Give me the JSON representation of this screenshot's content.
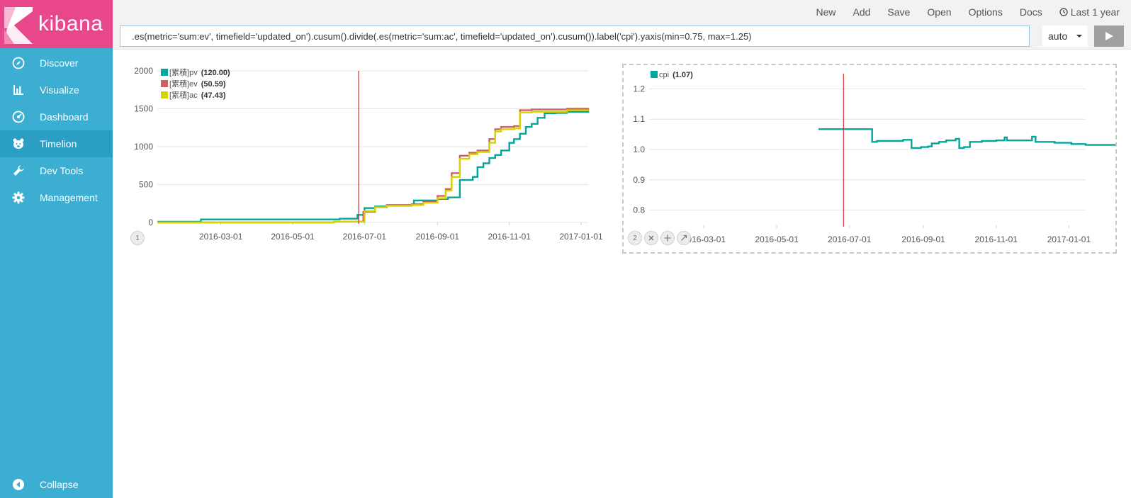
{
  "app": {
    "title": "kibana"
  },
  "sidebar": {
    "items": [
      {
        "label": "Discover",
        "icon": "compass-icon"
      },
      {
        "label": "Visualize",
        "icon": "bar-chart-icon"
      },
      {
        "label": "Dashboard",
        "icon": "gauge-icon"
      },
      {
        "label": "Timelion",
        "icon": "bear-icon"
      },
      {
        "label": "Dev Tools",
        "icon": "wrench-icon"
      },
      {
        "label": "Management",
        "icon": "gear-icon"
      }
    ],
    "active": "Timelion",
    "collapse_label": "Collapse"
  },
  "topmenu": {
    "new": "New",
    "add": "Add",
    "save": "Save",
    "open": "Open",
    "options": "Options",
    "docs": "Docs",
    "time_range": "Last 1 year"
  },
  "expression": ".es(metric='sum:ev', timefield='updated_on').cusum().divide(.es(metric='sum:ac', timefield='updated_on').cusum()).label('cpi').yaxis(min=0.75, max=1.25)",
  "interval": "auto",
  "colors": {
    "pv": "#00a69b",
    "ev": "#d0605e",
    "ac": "#d4d400",
    "marker": "#d63030",
    "sidebar": "#3caed2",
    "logo": "#e8488b"
  },
  "panels": {
    "panel1": {
      "index": "1"
    },
    "panel2": {
      "index": "2"
    }
  },
  "chart_data": [
    {
      "type": "line",
      "series": [
        {
          "name": "[累積]pv",
          "legend_value": "(120.00)",
          "points": [
            [
              "2016-01-07",
              10
            ],
            [
              "2016-02-12",
              10
            ],
            [
              "2016-02-13",
              40
            ],
            [
              "2016-06-10",
              40
            ],
            [
              "2016-06-10",
              50
            ],
            [
              "2016-06-22",
              50
            ],
            [
              "2016-06-25",
              100
            ],
            [
              "2016-07-01",
              190
            ],
            [
              "2016-07-10",
              210
            ],
            [
              "2016-07-20",
              230
            ],
            [
              "2016-08-10",
              230
            ],
            [
              "2016-08-12",
              290
            ],
            [
              "2016-08-31",
              290
            ],
            [
              "2016-09-01",
              310
            ],
            [
              "2016-09-10",
              330
            ],
            [
              "2016-09-20",
              560
            ],
            [
              "2016-10-01",
              600
            ],
            [
              "2016-10-05",
              730
            ],
            [
              "2016-10-10",
              780
            ],
            [
              "2016-10-15",
              850
            ],
            [
              "2016-10-20",
              890
            ],
            [
              "2016-10-25",
              950
            ],
            [
              "2016-11-01",
              1050
            ],
            [
              "2016-11-05",
              1100
            ],
            [
              "2016-11-10",
              1170
            ],
            [
              "2016-11-15",
              1260
            ],
            [
              "2016-11-20",
              1300
            ],
            [
              "2016-11-25",
              1380
            ],
            [
              "2016-12-01",
              1440
            ],
            [
              "2016-12-10",
              1445
            ],
            [
              "2016-12-20",
              1460
            ],
            [
              "2017-01-07",
              1500
            ]
          ]
        },
        {
          "name": "[累積]ev",
          "legend_value": "(50.59)",
          "points": [
            [
              "2016-01-07",
              0
            ],
            [
              "2016-06-04",
              0
            ],
            [
              "2016-06-05",
              10
            ],
            [
              "2016-06-28",
              10
            ],
            [
              "2016-06-30",
              140
            ],
            [
              "2016-07-10",
              200
            ],
            [
              "2016-07-20",
              230
            ],
            [
              "2016-08-10",
              240
            ],
            [
              "2016-08-20",
              270
            ],
            [
              "2016-09-01",
              350
            ],
            [
              "2016-09-08",
              440
            ],
            [
              "2016-09-13",
              650
            ],
            [
              "2016-09-20",
              880
            ],
            [
              "2016-09-28",
              920
            ],
            [
              "2016-10-05",
              950
            ],
            [
              "2016-10-15",
              1100
            ],
            [
              "2016-10-20",
              1230
            ],
            [
              "2016-10-25",
              1260
            ],
            [
              "2016-11-05",
              1270
            ],
            [
              "2016-11-10",
              1480
            ],
            [
              "2016-11-20",
              1490
            ],
            [
              "2016-12-20",
              1500
            ],
            [
              "2017-01-07",
              1510
            ]
          ]
        },
        {
          "name": "[累積]ac",
          "legend_value": "(47.43)",
          "points": [
            [
              "2016-01-07",
              0
            ],
            [
              "2016-06-04",
              0
            ],
            [
              "2016-06-05",
              10
            ],
            [
              "2016-06-28",
              10
            ],
            [
              "2016-07-01",
              150
            ],
            [
              "2016-07-10",
              200
            ],
            [
              "2016-07-20",
              220
            ],
            [
              "2016-08-10",
              230
            ],
            [
              "2016-08-20",
              260
            ],
            [
              "2016-09-01",
              320
            ],
            [
              "2016-09-08",
              420
            ],
            [
              "2016-09-13",
              600
            ],
            [
              "2016-09-20",
              840
            ],
            [
              "2016-09-28",
              900
            ],
            [
              "2016-10-05",
              930
            ],
            [
              "2016-10-15",
              1050
            ],
            [
              "2016-10-20",
              1200
            ],
            [
              "2016-10-25",
              1230
            ],
            [
              "2016-11-05",
              1240
            ],
            [
              "2016-11-10",
              1450
            ],
            [
              "2016-11-20",
              1460
            ],
            [
              "2016-12-20",
              1480
            ],
            [
              "2017-01-07",
              1490
            ]
          ]
        }
      ],
      "marker_date": "2016-06-26",
      "x_ticks": [
        "2016-03-01",
        "2016-05-01",
        "2016-07-01",
        "2016-09-01",
        "2016-11-01",
        "2017-01-01"
      ],
      "y_ticks": [
        0,
        500,
        1000,
        1500,
        2000
      ],
      "xlim": [
        "2016-01-07",
        "2017-01-07"
      ],
      "ylim": [
        0,
        2000
      ],
      "legend": "top-left",
      "grid": true
    },
    {
      "type": "line",
      "series": [
        {
          "name": "cpi",
          "legend_value": "(1.07)",
          "points": [
            [
              "2016-06-05",
              1.067
            ],
            [
              "2016-07-18",
              1.067
            ],
            [
              "2016-07-20",
              1.025
            ],
            [
              "2016-07-24",
              1.028
            ],
            [
              "2016-08-10",
              1.028
            ],
            [
              "2016-08-15",
              1.032
            ],
            [
              "2016-08-20",
              1.032
            ],
            [
              "2016-08-22",
              1.005
            ],
            [
              "2016-08-30",
              1.008
            ],
            [
              "2016-09-05",
              1.01
            ],
            [
              "2016-09-08",
              1.02
            ],
            [
              "2016-09-14",
              1.025
            ],
            [
              "2016-09-20",
              1.03
            ],
            [
              "2016-09-28",
              1.035
            ],
            [
              "2016-10-01",
              1.005
            ],
            [
              "2016-10-05",
              1.008
            ],
            [
              "2016-10-10",
              1.025
            ],
            [
              "2016-10-20",
              1.028
            ],
            [
              "2016-11-01",
              1.03
            ],
            [
              "2016-11-08",
              1.04
            ],
            [
              "2016-11-10",
              1.03
            ],
            [
              "2016-11-25",
              1.03
            ],
            [
              "2016-12-01",
              1.042
            ],
            [
              "2016-12-04",
              1.025
            ],
            [
              "2016-12-20",
              1.022
            ],
            [
              "2017-01-03",
              1.018
            ],
            [
              "2017-01-15",
              1.015
            ],
            [
              "2017-02-10",
              1.015
            ],
            [
              "2017-03-01",
              1.013
            ]
          ]
        }
      ],
      "marker_date": "2016-06-26",
      "x_ticks": [
        "2016-03-01",
        "2016-05-01",
        "2016-07-01",
        "2016-09-01",
        "2016-11-01",
        "2017-01-01"
      ],
      "y_ticks": [
        0.8,
        0.9,
        1.0,
        1.1,
        1.2
      ],
      "xlim": [
        "2016-01-15",
        "2017-01-15"
      ],
      "ylim": [
        0.75,
        1.25
      ],
      "legend": "top-left",
      "grid": true
    }
  ]
}
